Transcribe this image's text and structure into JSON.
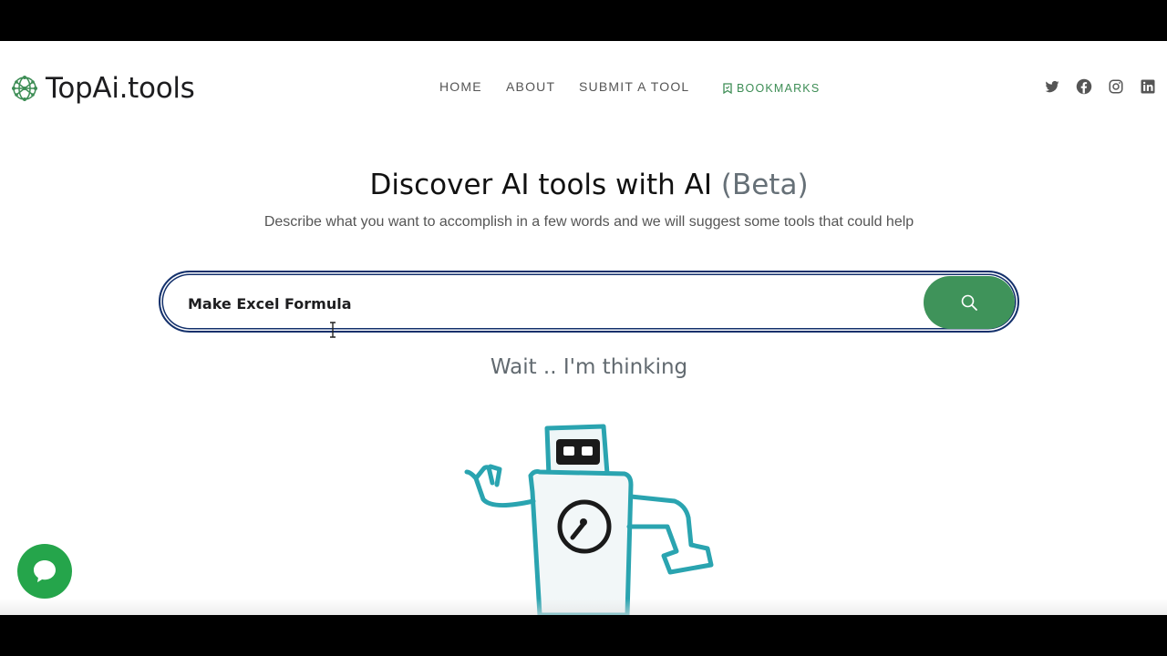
{
  "logo": {
    "text": "TopAi.tools",
    "icon": "network-globe-icon"
  },
  "nav": {
    "home": "HOME",
    "about": "ABOUT",
    "submit": "SUBMIT A TOOL",
    "bookmarks": "BOOKMARKS"
  },
  "social": [
    "twitter-icon",
    "facebook-icon",
    "instagram-icon",
    "linkedin-icon"
  ],
  "hero": {
    "title": "Discover AI tools with AI",
    "beta": "(Beta)",
    "subtitle": "Describe what you want to accomplish in a few words and we will suggest some tools that could help"
  },
  "search": {
    "value": "Make Excel Formula",
    "button_icon": "search-icon"
  },
  "status": {
    "thinking": "Wait .. I'm thinking"
  },
  "colors": {
    "accent_green": "#3f935a",
    "search_border": "#13306b",
    "chat_green": "#25a54b",
    "robot_teal": "#2aa4b0"
  }
}
